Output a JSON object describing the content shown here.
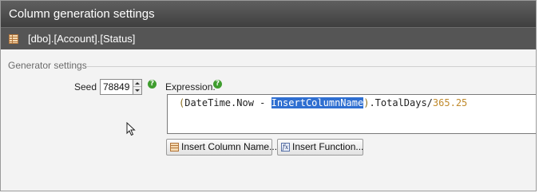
{
  "window": {
    "title": "Column generation settings",
    "column_path": "[dbo].[Account].[Status]"
  },
  "generator": {
    "section_label": "Generator settings",
    "seed_label": "Seed",
    "seed_value": "78849",
    "expression_label": "Expression:",
    "expression": {
      "open_paren": "(",
      "prefix": "DateTime.Now - ",
      "selected": "InsertColumnName",
      "close_paren": ")",
      "suffix": ".TotalDays/",
      "number": "365.25"
    },
    "help_glyph": "?"
  },
  "buttons": {
    "insert_column_name": "Insert Column Name...",
    "insert_function": "Insert Function..."
  },
  "icons": {
    "table": "table-icon",
    "help": "help-icon",
    "function": "function-icon",
    "cursor": "mouse-cursor-icon",
    "function_glyph": "fx"
  },
  "colors": {
    "title_bar": "#4a4a4a",
    "selection": "#2f6fd1",
    "help": "#3f9d2f"
  }
}
